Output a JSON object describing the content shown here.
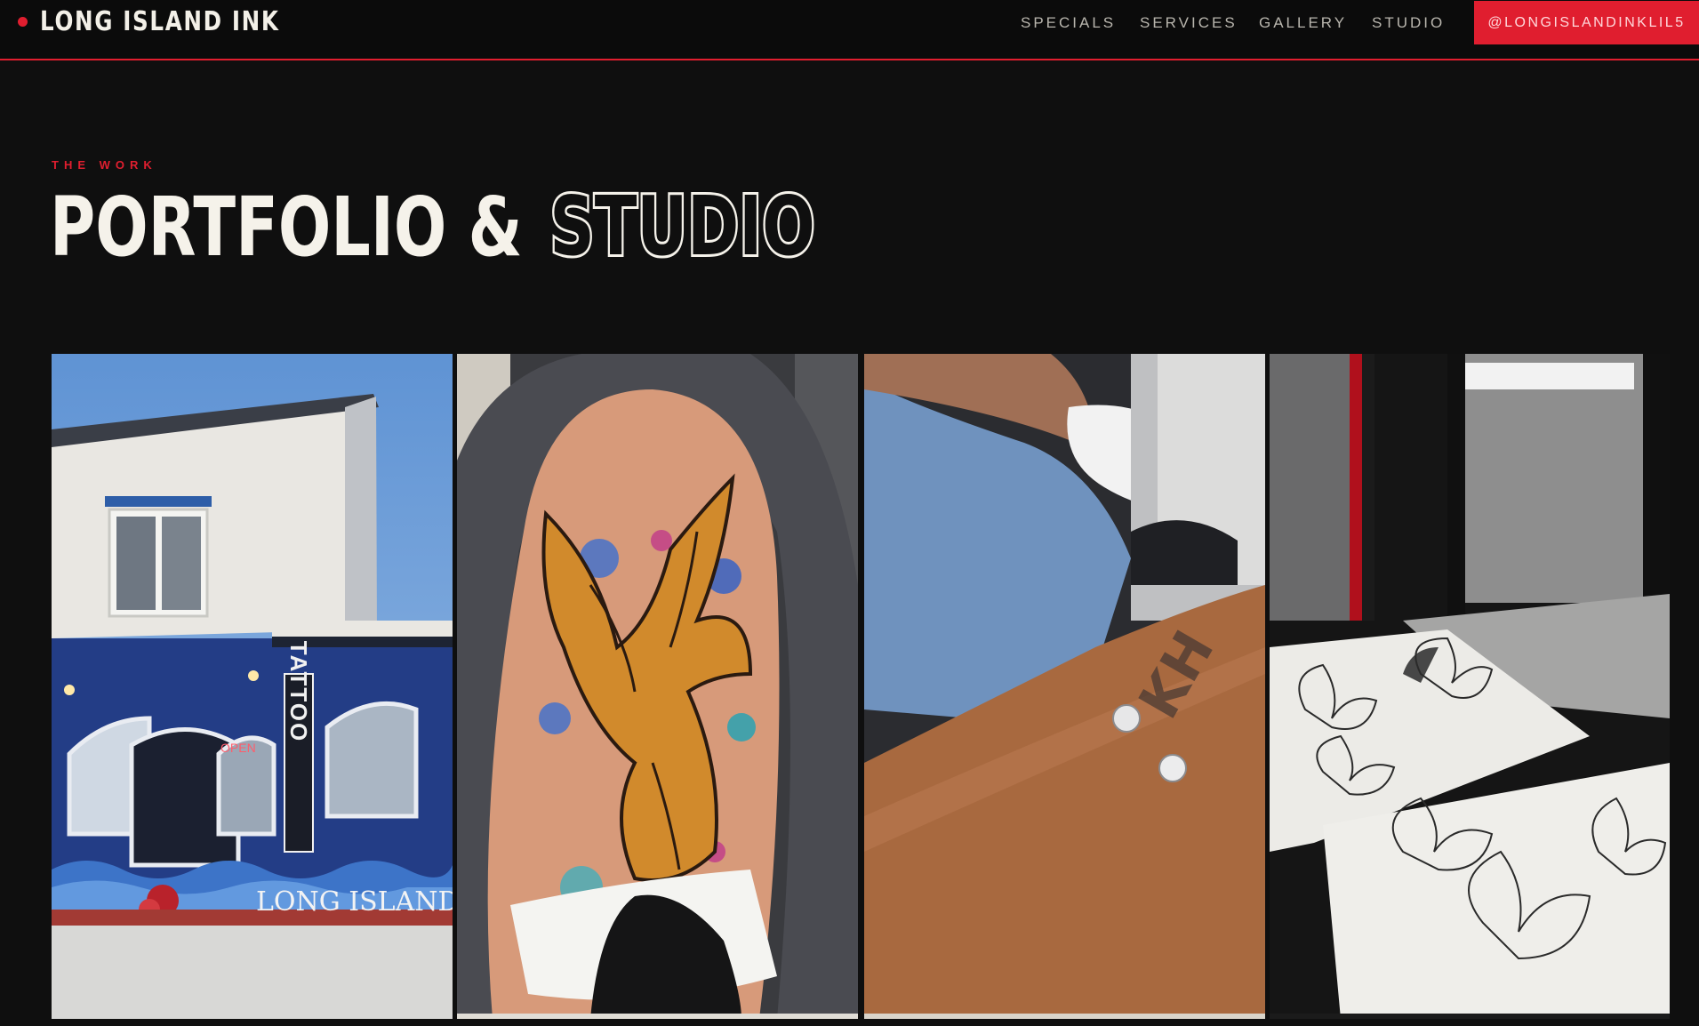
{
  "nav": {
    "brand": "LONG ISLAND INK",
    "links": [
      {
        "label": "SPECIALS"
      },
      {
        "label": "SERVICES"
      },
      {
        "label": "GALLERY"
      },
      {
        "label": "STUDIO"
      }
    ],
    "cta_label": "@LONGISLANDINKLIL5"
  },
  "section": {
    "eyebrow": "THE WORK",
    "title_solid": "PORTFOLIO &",
    "title_outline": "STUDIO"
  },
  "gallery": {
    "tiles": [
      {
        "subject": "studio storefront",
        "sign_tattoo": "TATTOO",
        "sign_open": "OPEN",
        "mural_text": "LONG ISLAND IN"
      },
      {
        "subject": "phoenix tattoo on shoulder"
      },
      {
        "subject": "dermal piercing on forearm"
      },
      {
        "subject": "butterfly flash sheets"
      }
    ]
  },
  "colors": {
    "background": "#0f0f0f",
    "accent": "#e01e2f",
    "text": "#f5f2ea",
    "nav_text": "#b9b6ae"
  }
}
